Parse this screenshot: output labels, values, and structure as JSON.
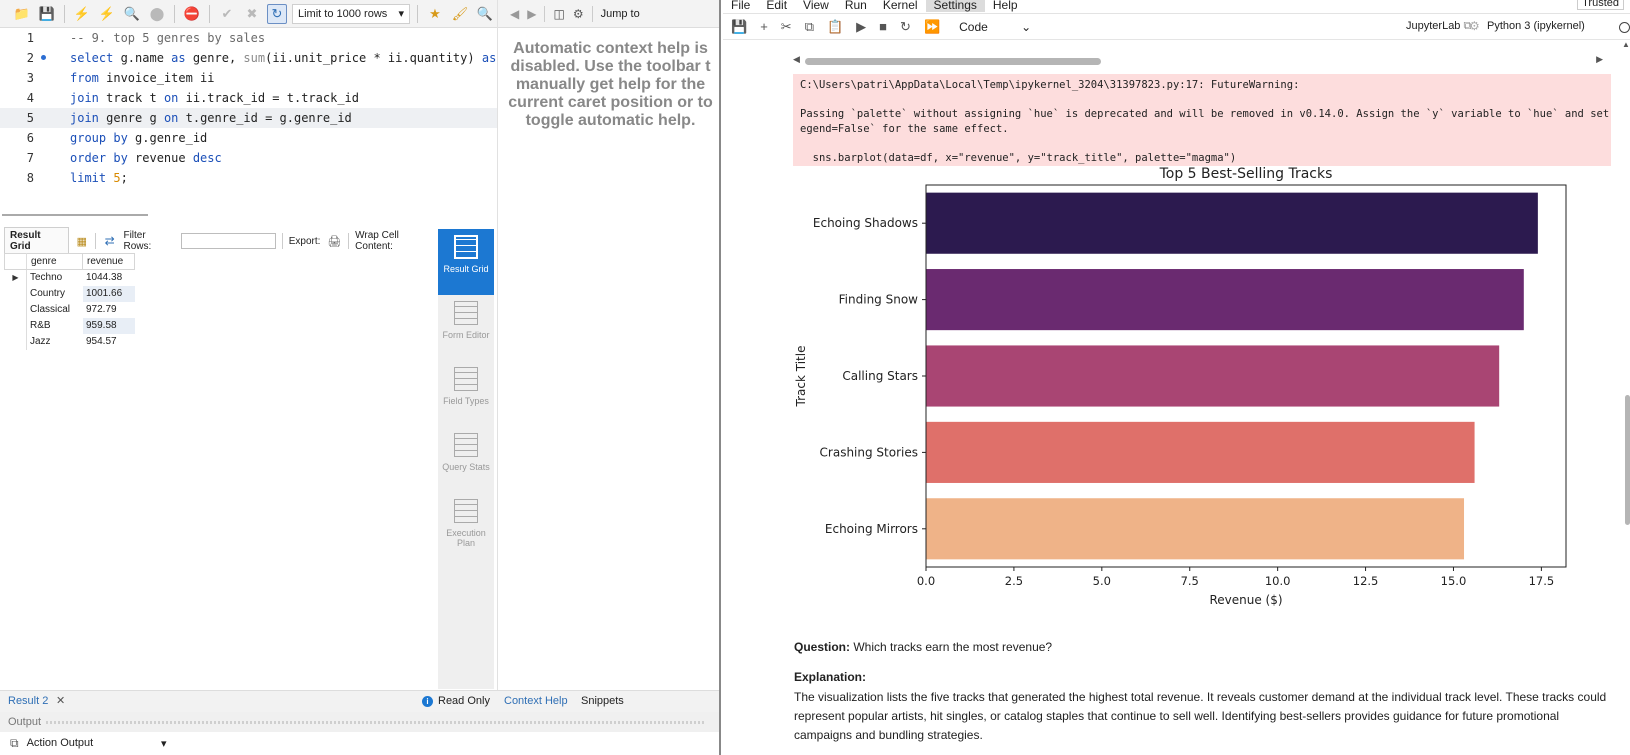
{
  "workbench": {
    "toolbar": {
      "limit_label": "Limit to 1000 rows"
    },
    "editor": {
      "lines": [
        {
          "num": "1",
          "parts": [
            {
              "t": "-- 9. top 5 genres by sales",
              "c": "cm"
            }
          ]
        },
        {
          "num": "2",
          "parts": [
            {
              "t": "select",
              "c": "kw"
            },
            {
              "t": " g.name ",
              "c": ""
            },
            {
              "t": "as",
              "c": "kw"
            },
            {
              "t": " genre, ",
              "c": ""
            },
            {
              "t": "sum",
              "c": "fn"
            },
            {
              "t": "(ii.unit_price * ii.quantity) ",
              "c": ""
            },
            {
              "t": "as",
              "c": "kw"
            },
            {
              "t": " reve",
              "c": ""
            }
          ]
        },
        {
          "num": "3",
          "parts": [
            {
              "t": "from",
              "c": "kw"
            },
            {
              "t": " invoice_item ii",
              "c": ""
            }
          ]
        },
        {
          "num": "4",
          "parts": [
            {
              "t": "join",
              "c": "kw"
            },
            {
              "t": " track t ",
              "c": ""
            },
            {
              "t": "on",
              "c": "kw"
            },
            {
              "t": " ii.track_id = t.track_id",
              "c": ""
            }
          ]
        },
        {
          "num": "5",
          "parts": [
            {
              "t": "join",
              "c": "kw"
            },
            {
              "t": " genre g ",
              "c": ""
            },
            {
              "t": "on",
              "c": "kw"
            },
            {
              "t": " t.genre_id = g.genre_id",
              "c": ""
            }
          ]
        },
        {
          "num": "6",
          "parts": [
            {
              "t": "group by",
              "c": "kw"
            },
            {
              "t": " g.genre_id",
              "c": ""
            }
          ]
        },
        {
          "num": "7",
          "parts": [
            {
              "t": "order by",
              "c": "kw"
            },
            {
              "t": " revenue ",
              "c": ""
            },
            {
              "t": "desc",
              "c": "kw"
            }
          ]
        },
        {
          "num": "8",
          "parts": [
            {
              "t": "limit",
              "c": "kw"
            },
            {
              "t": " ",
              "c": ""
            },
            {
              "t": "5",
              "c": "num"
            },
            {
              "t": ";",
              "c": ""
            }
          ]
        }
      ]
    },
    "result_toolbar": {
      "tab": "Result Grid",
      "filter_label": "Filter Rows:",
      "export_label": "Export:",
      "wrap_label": "Wrap Cell Content:"
    },
    "grid": {
      "headers": [
        "genre",
        "revenue"
      ],
      "rows": [
        [
          "Techno",
          "1044.38"
        ],
        [
          "Country",
          "1001.66"
        ],
        [
          "Classical",
          "972.79"
        ],
        [
          "R&B",
          "959.58"
        ],
        [
          "Jazz",
          "954.57"
        ]
      ]
    },
    "side_panel": [
      {
        "label": "Result Grid",
        "active": true
      },
      {
        "label": "Form Editor",
        "active": false
      },
      {
        "label": "Field Types",
        "active": false
      },
      {
        "label": "Query Stats",
        "active": false
      },
      {
        "label": "Execution Plan",
        "active": false
      }
    ],
    "help": {
      "jump_label": "Jump to",
      "text": "Automatic context help is disabled. Use the toolbar t manually get help for the current caret position or to toggle automatic help."
    },
    "bottom": {
      "result_tab": "Result 2",
      "readonly": "Read Only",
      "context_help_tab": "Context Help",
      "snippets_tab": "Snippets",
      "output_label": "Output",
      "action_output": "Action Output"
    }
  },
  "jupyter": {
    "menu": [
      "File",
      "Edit",
      "View",
      "Run",
      "Kernel",
      "Settings",
      "Help"
    ],
    "active_menu": "Settings",
    "trusted": "Trusted",
    "cell_type": "Code",
    "jlab_link": "JupyterLab",
    "kernel": "Python 3 (ipykernel)",
    "warning_lines": [
      "C:\\Users\\patri\\AppData\\Local\\Temp\\ipykernel_3204\\31397823.py:17: FutureWarning:",
      "",
      "Passing `palette` without assigning `hue` is deprecated and will be removed in v0.14.0. Assign the `y` variable to `hue` and set `l",
      "egend=False` for the same effect.",
      "",
      "  sns.barplot(data=df, x=\"revenue\", y=\"track_title\", palette=\"magma\")"
    ],
    "question_label": "Question:",
    "question_text": " Which tracks earn the most revenue?",
    "explanation_label": "Explanation:",
    "explanation_text": "The visualization lists the five tracks that generated the highest total revenue. It reveals customer demand at the individual track level. These tracks could represent popular artists, hit singles, or catalog staples that continue to sell well. Identifying best-sellers provides guidance for future promotional campaigns and bundling strategies."
  },
  "chart_data": {
    "type": "bar",
    "orientation": "horizontal",
    "title": "Top 5 Best-Selling Tracks",
    "xlabel": "Revenue ($)",
    "ylabel": "Track Title",
    "categories": [
      "Echoing Shadows",
      "Finding Snow",
      "Calling Stars",
      "Crashing Stories",
      "Echoing Mirrors"
    ],
    "values": [
      17.4,
      17.0,
      16.3,
      15.6,
      15.3
    ],
    "colors": [
      "#2c1a4f",
      "#6a2a70",
      "#a94573",
      "#df706a",
      "#efb388"
    ],
    "xlim": [
      0,
      18.2
    ],
    "xticks": [
      "0.0",
      "2.5",
      "5.0",
      "7.5",
      "10.0",
      "12.5",
      "15.0",
      "17.5"
    ],
    "xtick_values": [
      0,
      2.5,
      5,
      7.5,
      10,
      12.5,
      15,
      17.5
    ],
    "grid": false
  }
}
